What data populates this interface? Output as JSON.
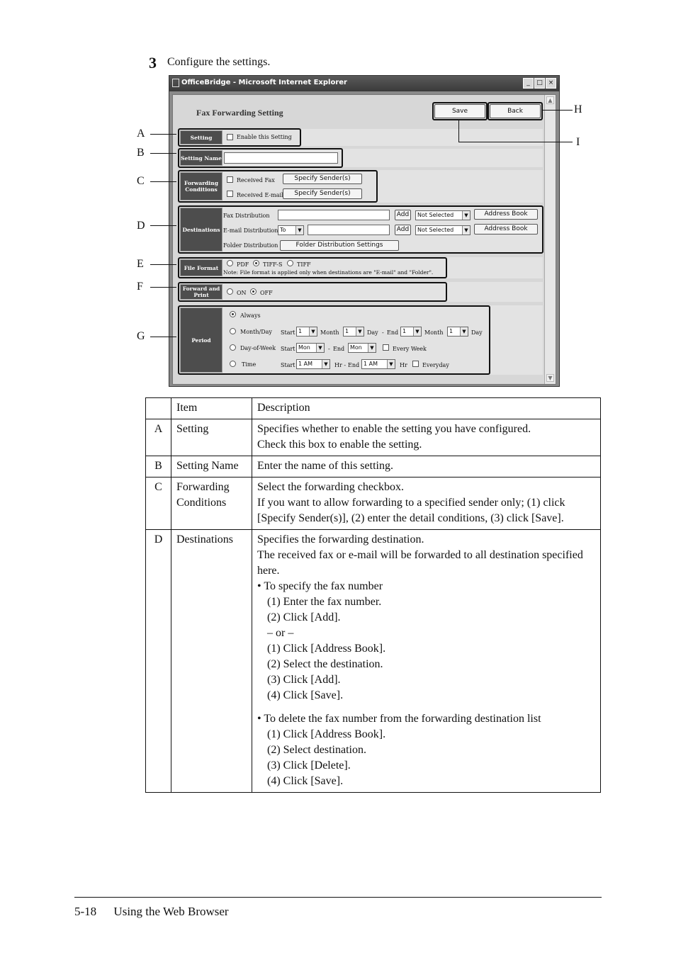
{
  "step": {
    "number": "3",
    "text": "Configure the settings."
  },
  "window": {
    "title": "OfficeBridge - Microsoft Internet Explorer",
    "controls": [
      "_",
      "□",
      "×"
    ],
    "page_title": "Fax Forwarding Setting",
    "save": "Save",
    "back": "Back",
    "setting": {
      "label": "Setting",
      "checkbox": "Enable this Setting"
    },
    "setting_name": {
      "label": "Setting Name"
    },
    "forwarding": {
      "label": "Forwarding Conditions",
      "received_fax": "Received Fax",
      "received_email": "Received E-mail",
      "specify_sender": "Specify Sender(s)"
    },
    "destinations": {
      "label": "Destinations",
      "fax_distribution": "Fax Distribution",
      "email_distribution": "E-mail Distribution",
      "folder_distribution": "Folder Distribution",
      "to": "To",
      "add": "Add",
      "not_selected": "Not Selected",
      "address_book": "Address Book",
      "folder_settings": "Folder Distribution Settings"
    },
    "file_format": {
      "label": "File Format",
      "options": [
        "PDF",
        "TIFF-S",
        "TIFF"
      ],
      "note": "Note: File format is applied only when destinations are \"E-mail\" and \"Folder\"."
    },
    "forward_print": {
      "label": "Forward and Print",
      "on": "ON",
      "off": "OFF"
    },
    "period": {
      "label": "Period",
      "always": "Always",
      "month_day": "Month/Day",
      "day_of_week": "Day-of-Week",
      "time": "Time",
      "start": "Start",
      "end": "End",
      "month": "Month",
      "day": "Day",
      "one": "1",
      "mon": "Mon",
      "one_am": "1 AM",
      "hr": "Hr",
      "every_week": "Every Week",
      "everyday": "Everyday",
      "dash": "-",
      "hr_dash": "Hr -"
    }
  },
  "callouts": [
    "A",
    "B",
    "C",
    "D",
    "E",
    "F",
    "G",
    "H",
    "I"
  ],
  "table": {
    "headers": [
      "",
      "Item",
      "Description"
    ],
    "rows": [
      {
        "key": "A",
        "item": "Setting",
        "desc": [
          "Specifies whether to enable the setting you have configured.",
          "Check this box to enable the setting."
        ]
      },
      {
        "key": "B",
        "item": "Setting Name",
        "desc": [
          "Enter the name of this setting."
        ]
      },
      {
        "key": "C",
        "item": "Forwarding Conditions",
        "desc": [
          "Select the forwarding checkbox.",
          "If you want to allow forwarding to a specified sender only; (1) click [Specify Sender(s)], (2) enter the detail conditions, (3) click [Save]."
        ]
      },
      {
        "key": "D",
        "item": "Destinations",
        "intro": [
          "Specifies the forwarding destination.",
          "The received fax or e-mail will be forwarded to all destination specified here."
        ],
        "bullet1": "• To specify the fax number",
        "steps1": [
          "(1) Enter the fax number.",
          "(2) Click [Add].",
          "– or –",
          "(1) Click [Address Book].",
          "(2) Select the destination.",
          "(3) Click [Add].",
          "(4) Click [Save]."
        ],
        "bullet2": "• To delete the fax number from the forwarding destination list",
        "steps2": [
          "(1) Click [Address Book].",
          "(2) Select destination.",
          "(3) Click [Delete].",
          "(4) Click [Save]."
        ]
      }
    ]
  },
  "footer": {
    "page": "5-18",
    "section": "Using the Web Browser"
  }
}
